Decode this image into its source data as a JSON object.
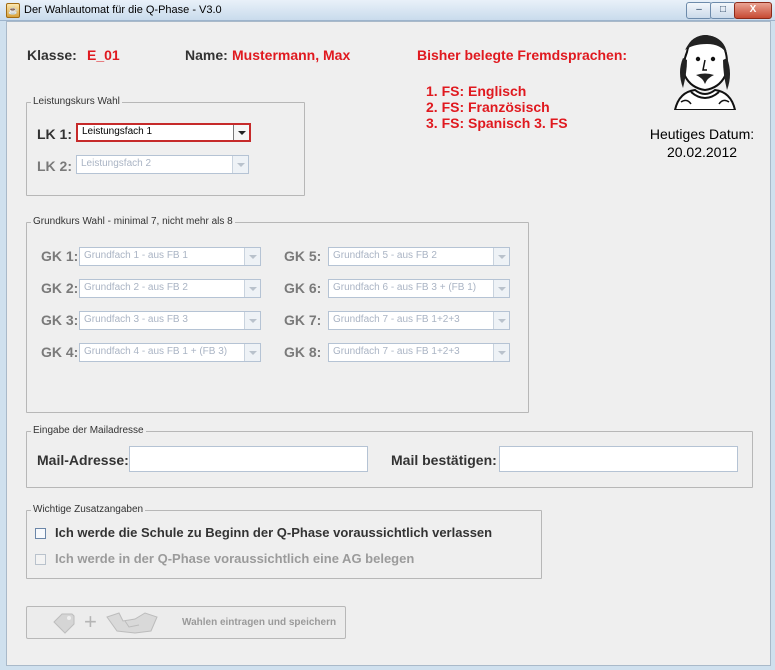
{
  "window": {
    "title": "Der Wahlautomat für die Q-Phase - V3.0",
    "controls": {
      "minimize": "–",
      "maximize": "□",
      "close": "X"
    }
  },
  "header": {
    "klasse_label": "Klasse:",
    "klasse_value": "E_01",
    "name_label": "Name:",
    "name_value": "Mustermann, Max",
    "fremdsprachen_title": "Bisher belegte Fremdsprachen:",
    "fremdsprachen": [
      "1. FS: Englisch",
      "2. FS: Französisch",
      "3. FS: Spanisch 3. FS"
    ],
    "date_label": "Heutiges Datum:",
    "date_value": "20.02.2012"
  },
  "leistungskurs": {
    "title": "Leistungskurs Wahl",
    "rows": [
      {
        "label": "LK 1:",
        "value": "Leistungsfach 1"
      },
      {
        "label": "LK 2:",
        "value": "Leistungsfach 2"
      }
    ]
  },
  "grundkurs": {
    "title": "Grundkurs Wahl - minimal 7, nicht mehr als 8",
    "left": [
      {
        "label": "GK 1:",
        "value": "Grundfach 1 - aus FB 1"
      },
      {
        "label": "GK 2:",
        "value": "Grundfach 2 - aus FB 2"
      },
      {
        "label": "GK 3:",
        "value": "Grundfach 3 - aus FB 3"
      },
      {
        "label": "GK 4:",
        "value": "Grundfach 4 - aus FB 1 + (FB 3)"
      }
    ],
    "right": [
      {
        "label": "GK 5:",
        "value": "Grundfach 5 - aus FB 2"
      },
      {
        "label": "GK 6:",
        "value": "Grundfach 6 - aus FB 3 + (FB 1)"
      },
      {
        "label": "GK 7:",
        "value": "Grundfach 7 - aus FB 1+2+3"
      },
      {
        "label": "GK 8:",
        "value": "Grundfach 7 - aus FB 1+2+3"
      }
    ]
  },
  "mail": {
    "title": "Eingabe der Mailadresse",
    "address_label": "Mail-Adresse:",
    "address_value": "",
    "confirm_label": "Mail bestätigen:",
    "confirm_value": ""
  },
  "zusatz": {
    "title": "Wichtige Zusatzangaben",
    "options": [
      {
        "label": "Ich werde die Schule zu Beginn der Q-Phase voraussichtlich verlassen",
        "checked": false
      },
      {
        "label": "Ich werde in der Q-Phase voraussichtlich eine AG belegen",
        "checked": false
      }
    ]
  },
  "save_button": {
    "plus": "+",
    "label": "Wahlen eintragen und speichern"
  },
  "colors": {
    "accent_red": "#e0191f",
    "active_border": "#c62a2a"
  }
}
